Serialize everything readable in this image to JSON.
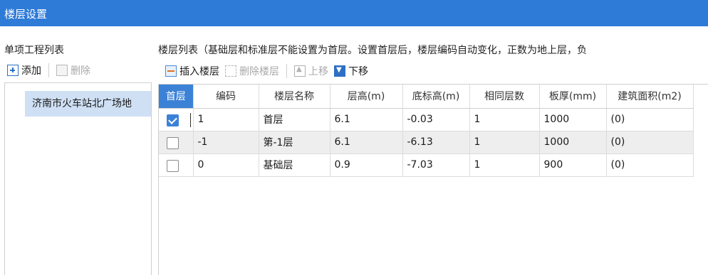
{
  "window": {
    "title": "楼层设置"
  },
  "left": {
    "header": "单项工程列表",
    "toolbar": {
      "add_label": "添加",
      "delete_label": "删除"
    },
    "projects": [
      "济南市火车站北广场地"
    ]
  },
  "right": {
    "header": "楼层列表（基础层和标准层不能设置为首层。设置首层后，楼层编码自动变化，正数为地上层，负",
    "toolbar": {
      "insert_label": "插入楼层",
      "delete_label": "删除楼层",
      "up_label": "上移",
      "down_label": "下移"
    },
    "columns": [
      "首层",
      "编码",
      "楼层名称",
      "层高(m)",
      "底标高(m)",
      "相同层数",
      "板厚(mm)",
      "建筑面积(m2)"
    ],
    "rows": [
      {
        "first": true,
        "code": "1",
        "name": "首层",
        "height": "6.1",
        "base": "-0.03",
        "same": "1",
        "thick": "1000",
        "area": "(0)"
      },
      {
        "first": false,
        "code": "-1",
        "name": "第-1层",
        "height": "6.1",
        "base": "-6.13",
        "same": "1",
        "thick": "1000",
        "area": "(0)"
      },
      {
        "first": false,
        "code": "0",
        "name": "基础层",
        "height": "0.9",
        "base": "-7.03",
        "same": "1",
        "thick": "900",
        "area": "(0)"
      }
    ]
  },
  "colors": {
    "titlebar": "#2e7ad7",
    "selection": "#cfe0f5",
    "checkbox": "#3b82d6"
  }
}
